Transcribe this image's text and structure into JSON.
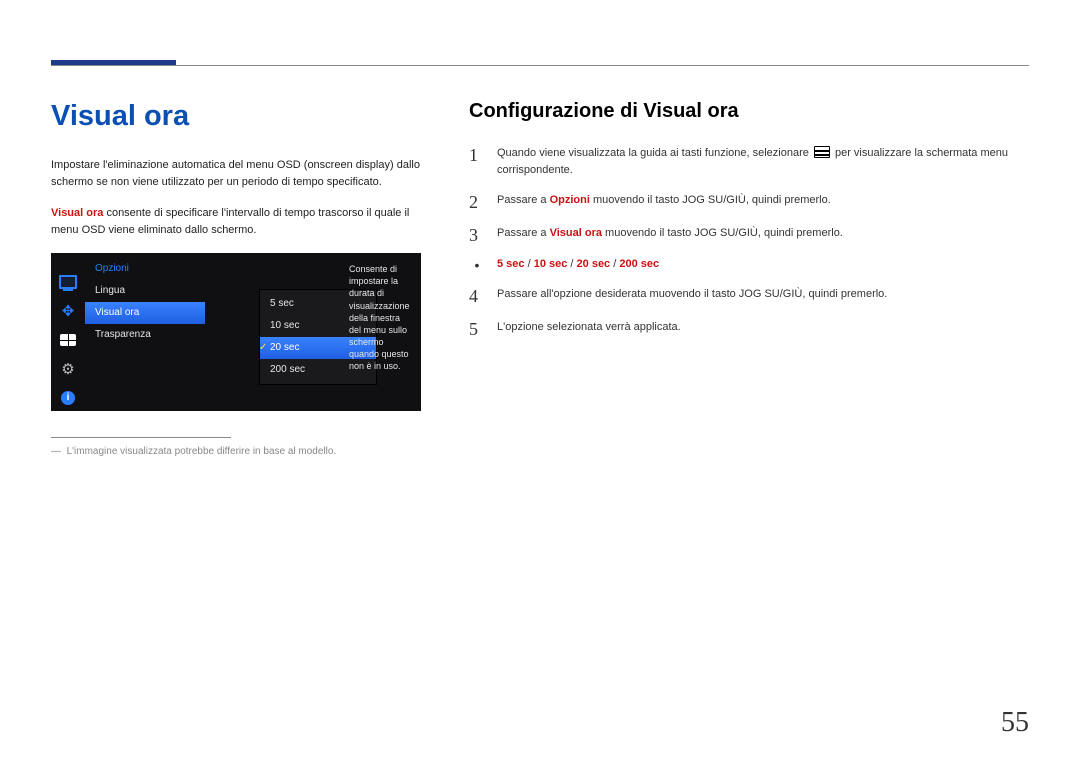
{
  "left": {
    "heading": "Visual ora",
    "intro_1": "Impostare l'eliminazione automatica del menu OSD (onscreen display) dallo schermo se non viene utilizzato per un periodo di tempo specificato.",
    "intro_2_bold": "Visual ora",
    "intro_2_rest": " consente di specificare l'intervallo di tempo trascorso il quale il menu OSD viene eliminato dallo schermo.",
    "footnote_dash": "―",
    "footnote": "L'immagine visualizzata potrebbe differire in base al modello."
  },
  "osd": {
    "title": "Opzioni",
    "items": [
      "Lingua",
      "Visual ora",
      "Trasparenza"
    ],
    "selected_index": 1,
    "options": [
      "5 sec",
      "10 sec",
      "20 sec",
      "200 sec"
    ],
    "option_selected_index": 2,
    "desc": "Consente di impostare la durata di visualizzazione della finestra del menu sullo schermo quando questo non è in uso."
  },
  "right": {
    "heading": "Configurazione di Visual ora",
    "steps": [
      {
        "n": "1",
        "pre": "Quando viene visualizzata la guida ai tasti funzione, selezionare ",
        "post": " per visualizzare la schermata menu corrispondente.",
        "icon": true
      },
      {
        "n": "2",
        "pre": "Passare a ",
        "bold": "Opzioni",
        "post": " muovendo il tasto JOG SU/GIÙ, quindi premerlo."
      },
      {
        "n": "3",
        "pre": "Passare a ",
        "bold": "Visual ora",
        "post": " muovendo il tasto JOG SU/GIÙ, quindi premerlo."
      },
      {
        "n": "4",
        "pre": "Passare all'opzione desiderata muovendo il tasto JOG SU/GIÙ, quindi premerlo."
      },
      {
        "n": "5",
        "pre": "L'opzione selezionata verrà applicata."
      }
    ],
    "options_values": [
      "5 sec",
      "10 sec",
      "20 sec",
      "200 sec"
    ]
  },
  "page_number": "55"
}
